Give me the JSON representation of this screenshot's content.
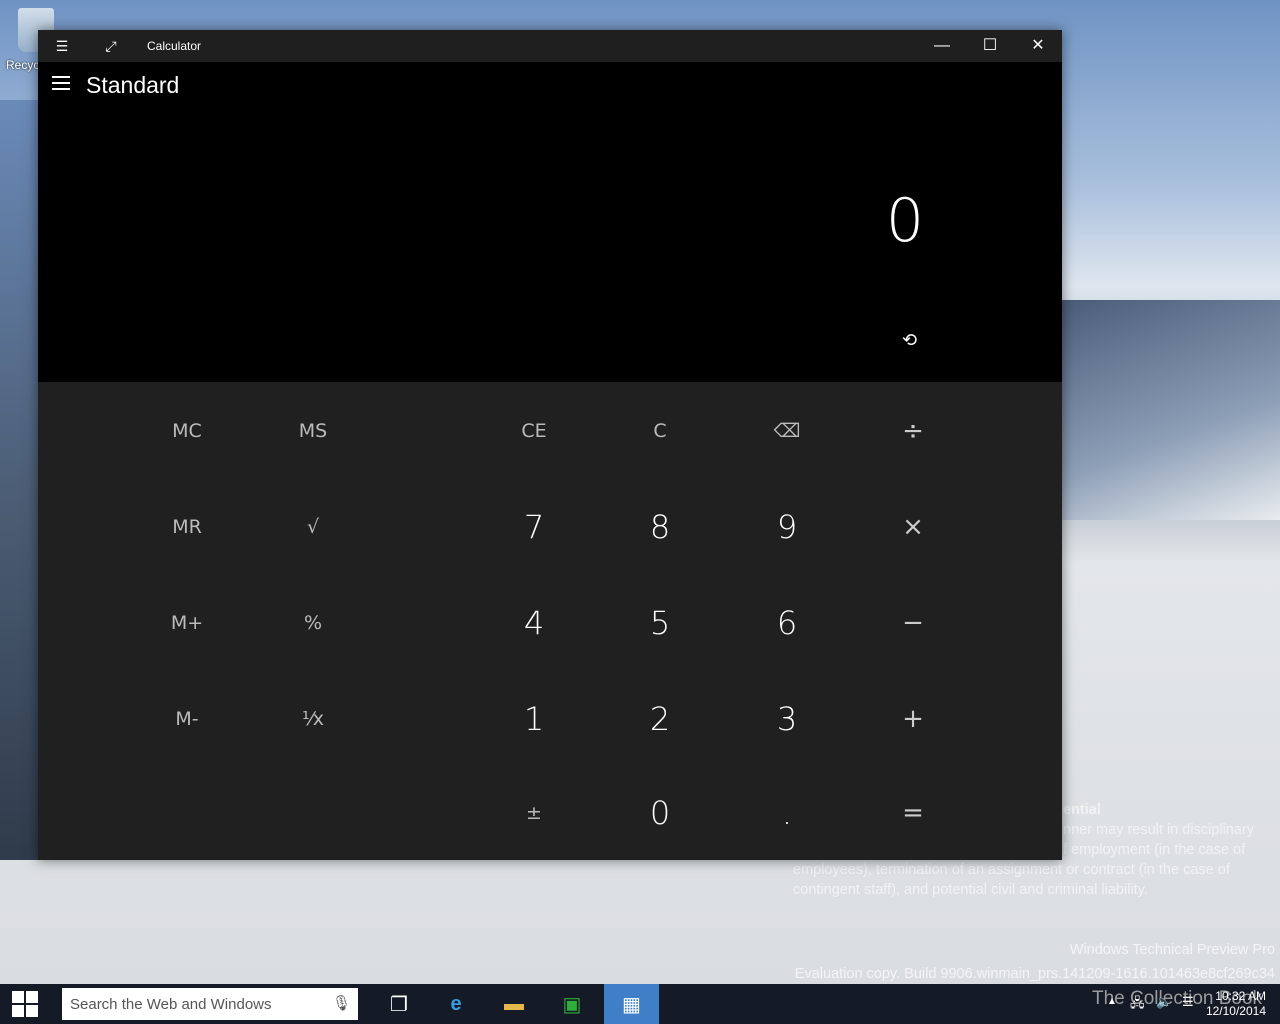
{
  "desktop": {
    "recycle_label": "Recyc",
    "watermark_lines": [
      "ential",
      "nner may result in disciplinary",
      "f employment (in the case of",
      "employees), termination of an assignment or contract (in the case of",
      "contingent staff), and potential civil and criminal liability."
    ],
    "edition": "Windows Technical Preview Pro",
    "build": "Evaluation copy. Build 9906.winmain_prs.141209-1616.101463e8cf269c34",
    "logo_text": "The Collection Book"
  },
  "window": {
    "title": "Calculator",
    "mode": "Standard",
    "display": "0"
  },
  "keys": [
    {
      "label": "MC",
      "kind": "mem",
      "name": "memory-clear-button"
    },
    {
      "label": "MS",
      "kind": "mem",
      "name": "memory-store-button"
    },
    {
      "label": "CE",
      "kind": "mem",
      "name": "clear-entry-button"
    },
    {
      "label": "C",
      "kind": "mem",
      "name": "clear-button"
    },
    {
      "label": "⌫",
      "kind": "mem",
      "name": "backspace-button"
    },
    {
      "label": "÷",
      "kind": "op",
      "name": "divide-button"
    },
    {
      "label": "MR",
      "kind": "mem",
      "name": "memory-recall-button"
    },
    {
      "label": "√",
      "kind": "mem",
      "name": "square-root-button"
    },
    {
      "label": "7",
      "kind": "num",
      "name": "digit-7-button"
    },
    {
      "label": "8",
      "kind": "num",
      "name": "digit-8-button"
    },
    {
      "label": "9",
      "kind": "num",
      "name": "digit-9-button"
    },
    {
      "label": "×",
      "kind": "op",
      "name": "multiply-button"
    },
    {
      "label": "M+",
      "kind": "mem",
      "name": "memory-add-button"
    },
    {
      "label": "%",
      "kind": "mem",
      "name": "percent-button"
    },
    {
      "label": "4",
      "kind": "num",
      "name": "digit-4-button"
    },
    {
      "label": "5",
      "kind": "num",
      "name": "digit-5-button"
    },
    {
      "label": "6",
      "kind": "num",
      "name": "digit-6-button"
    },
    {
      "label": "−",
      "kind": "op",
      "name": "subtract-button"
    },
    {
      "label": "M-",
      "kind": "mem",
      "name": "memory-subtract-button"
    },
    {
      "label": "¹⁄x",
      "kind": "mem",
      "name": "reciprocal-button"
    },
    {
      "label": "1",
      "kind": "num",
      "name": "digit-1-button"
    },
    {
      "label": "2",
      "kind": "num",
      "name": "digit-2-button"
    },
    {
      "label": "3",
      "kind": "num",
      "name": "digit-3-button"
    },
    {
      "label": "+",
      "kind": "op",
      "name": "add-button"
    },
    {
      "label": "",
      "kind": "mem",
      "name": "empty-slot"
    },
    {
      "label": "",
      "kind": "mem",
      "name": "empty-slot"
    },
    {
      "label": "±",
      "kind": "mem",
      "name": "negate-button"
    },
    {
      "label": "0",
      "kind": "num",
      "name": "digit-0-button"
    },
    {
      "label": ".",
      "kind": "num",
      "name": "decimal-button"
    },
    {
      "label": "=",
      "kind": "op",
      "name": "equals-button"
    }
  ],
  "taskbar": {
    "search_placeholder": "Search the Web and Windows",
    "time": "10:32 AM",
    "date": "12/10/2014"
  }
}
